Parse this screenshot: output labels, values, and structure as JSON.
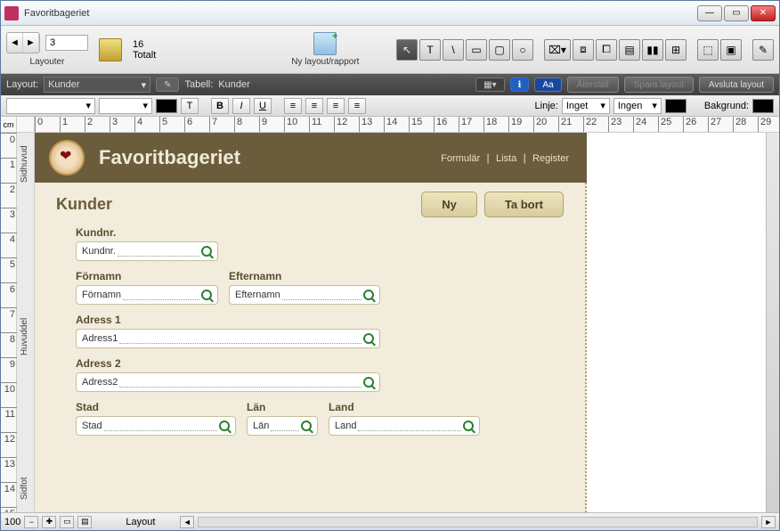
{
  "window": {
    "title": "Favoritbageriet"
  },
  "toolbar": {
    "layout_number": "3",
    "layouter_label": "Layouter",
    "total_count": "16",
    "total_label": "Totalt",
    "new_layout_label": "Ny layout/rapport"
  },
  "darkbar": {
    "layout_label": "Layout:",
    "layout_value": "Kunder",
    "table_label": "Tabell:",
    "table_value": "Kunder",
    "reset": "Återställ",
    "save": "Spara layout",
    "exit": "Avsluta layout"
  },
  "fmtbar": {
    "line_label": "Linje:",
    "line_value": "Inget",
    "line_weight": "Ingen",
    "bg_label": "Bakgrund:"
  },
  "ruler": {
    "unit": "cm"
  },
  "parts": {
    "header": "Sidhuvud",
    "body": "Huvuddel",
    "footer": "Sidfot"
  },
  "form": {
    "brand": "Favoritbageriet",
    "links": {
      "form": "Formulär",
      "list": "Lista",
      "register": "Register"
    },
    "title": "Kunder",
    "btn_new": "Ny",
    "btn_delete": "Ta bort",
    "fields": {
      "kundnr_label": "Kundnr.",
      "kundnr_ph": "Kundnr.",
      "fornamn_label": "Förnamn",
      "fornamn_ph": "Förnamn",
      "efternamn_label": "Efternamn",
      "efternamn_ph": "Efternamn",
      "adress1_label": "Adress 1",
      "adress1_ph": "Adress1",
      "adress2_label": "Adress 2",
      "adress2_ph": "Adress2",
      "stad_label": "Stad",
      "stad_ph": "Stad",
      "lan_label": "Län",
      "lan_ph": "Län",
      "land_label": "Land",
      "land_ph": "Land"
    }
  },
  "statusbar": {
    "zoom": "100",
    "mode": "Layout"
  }
}
